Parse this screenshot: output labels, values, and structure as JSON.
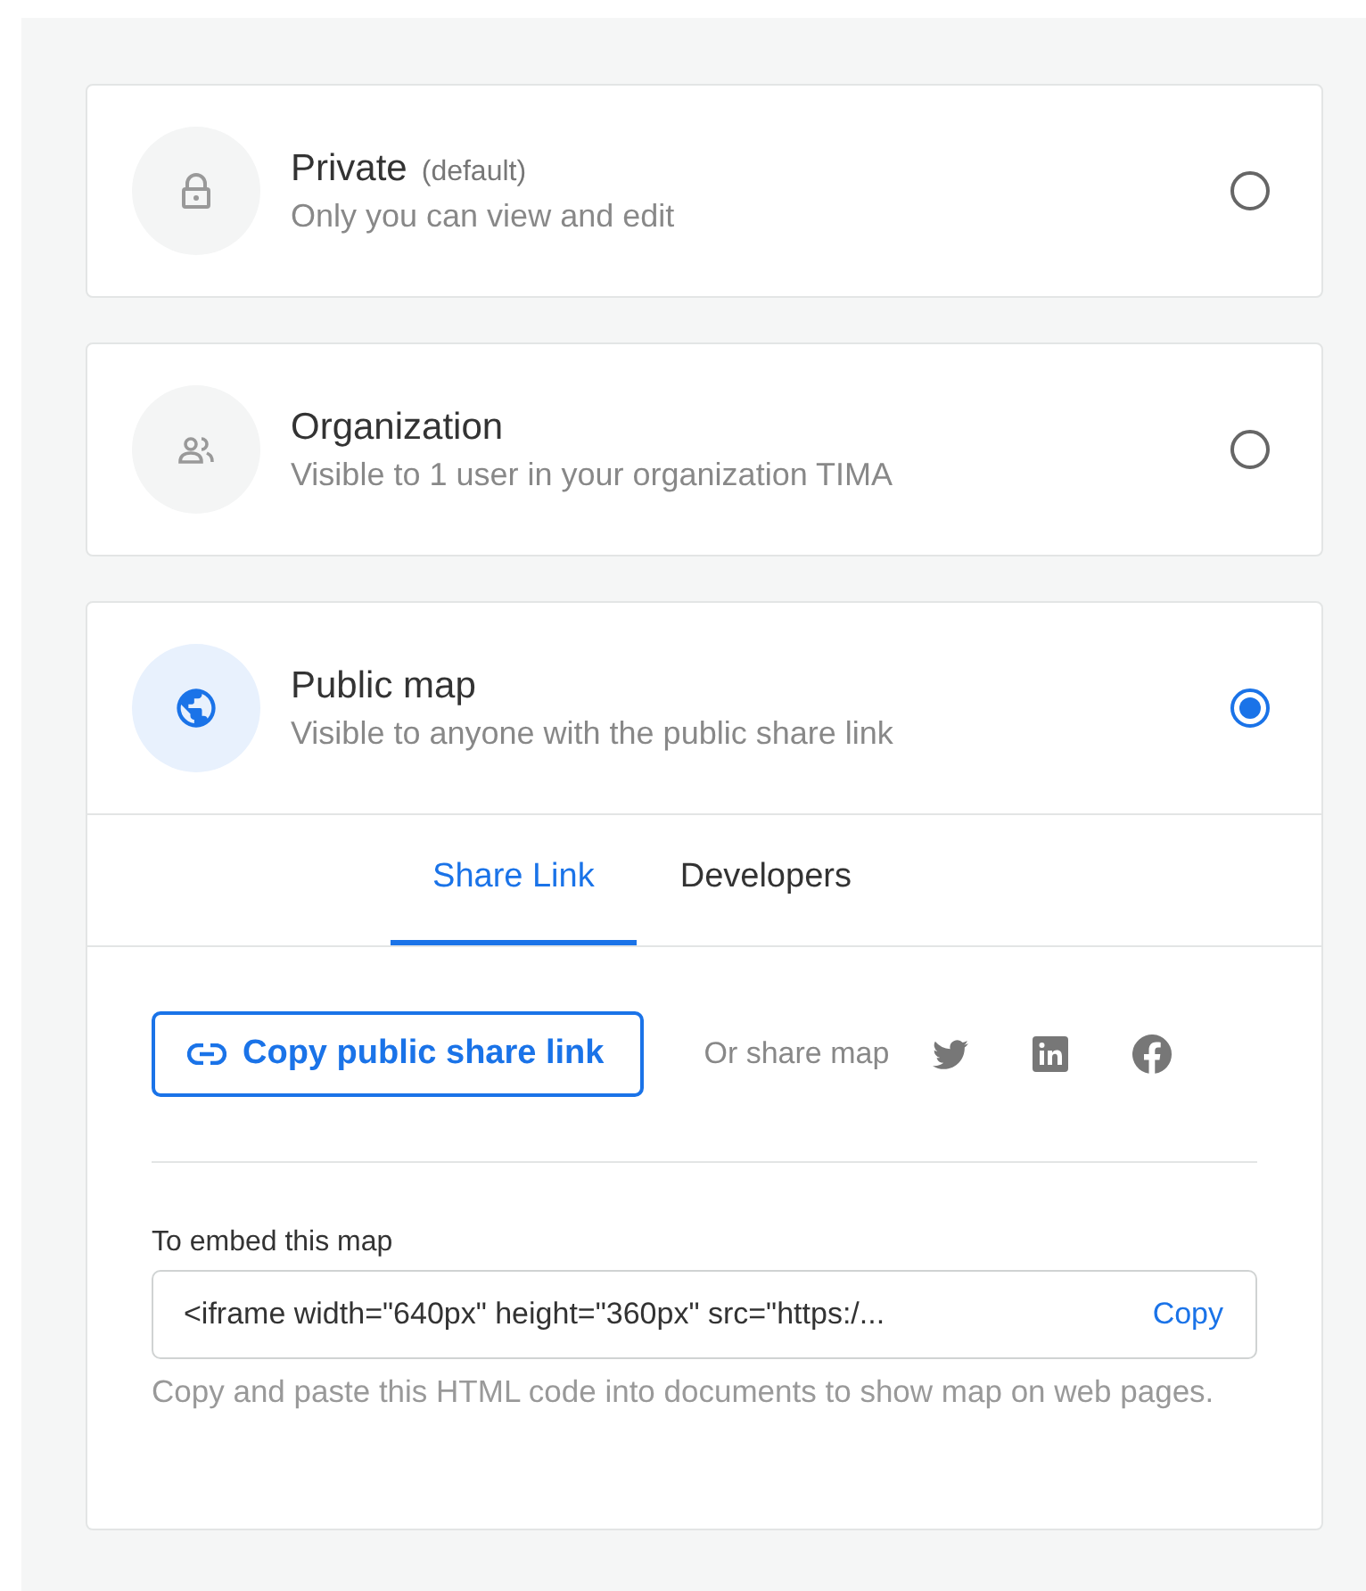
{
  "options": [
    {
      "title": "Private",
      "note": "(default)",
      "description": "Only you can view and edit",
      "selected": false
    },
    {
      "title": "Organization",
      "description": "Visible to 1 user in your organization TIMA",
      "selected": false
    },
    {
      "title": "Public map",
      "description": "Visible to anyone with the public share link",
      "selected": true
    }
  ],
  "tabs": [
    {
      "label": "Share Link",
      "selected": true
    },
    {
      "label": "Developers",
      "selected": false
    }
  ],
  "share": {
    "button": "Copy public share link",
    "or_label": "Or share map"
  },
  "embed": {
    "label": "To embed this map",
    "code": "<iframe width=\"640px\" height=\"360px\" src=\"https:/...",
    "copy": "Copy",
    "help": "Copy and paste this HTML code into documents to show map on web pages."
  }
}
